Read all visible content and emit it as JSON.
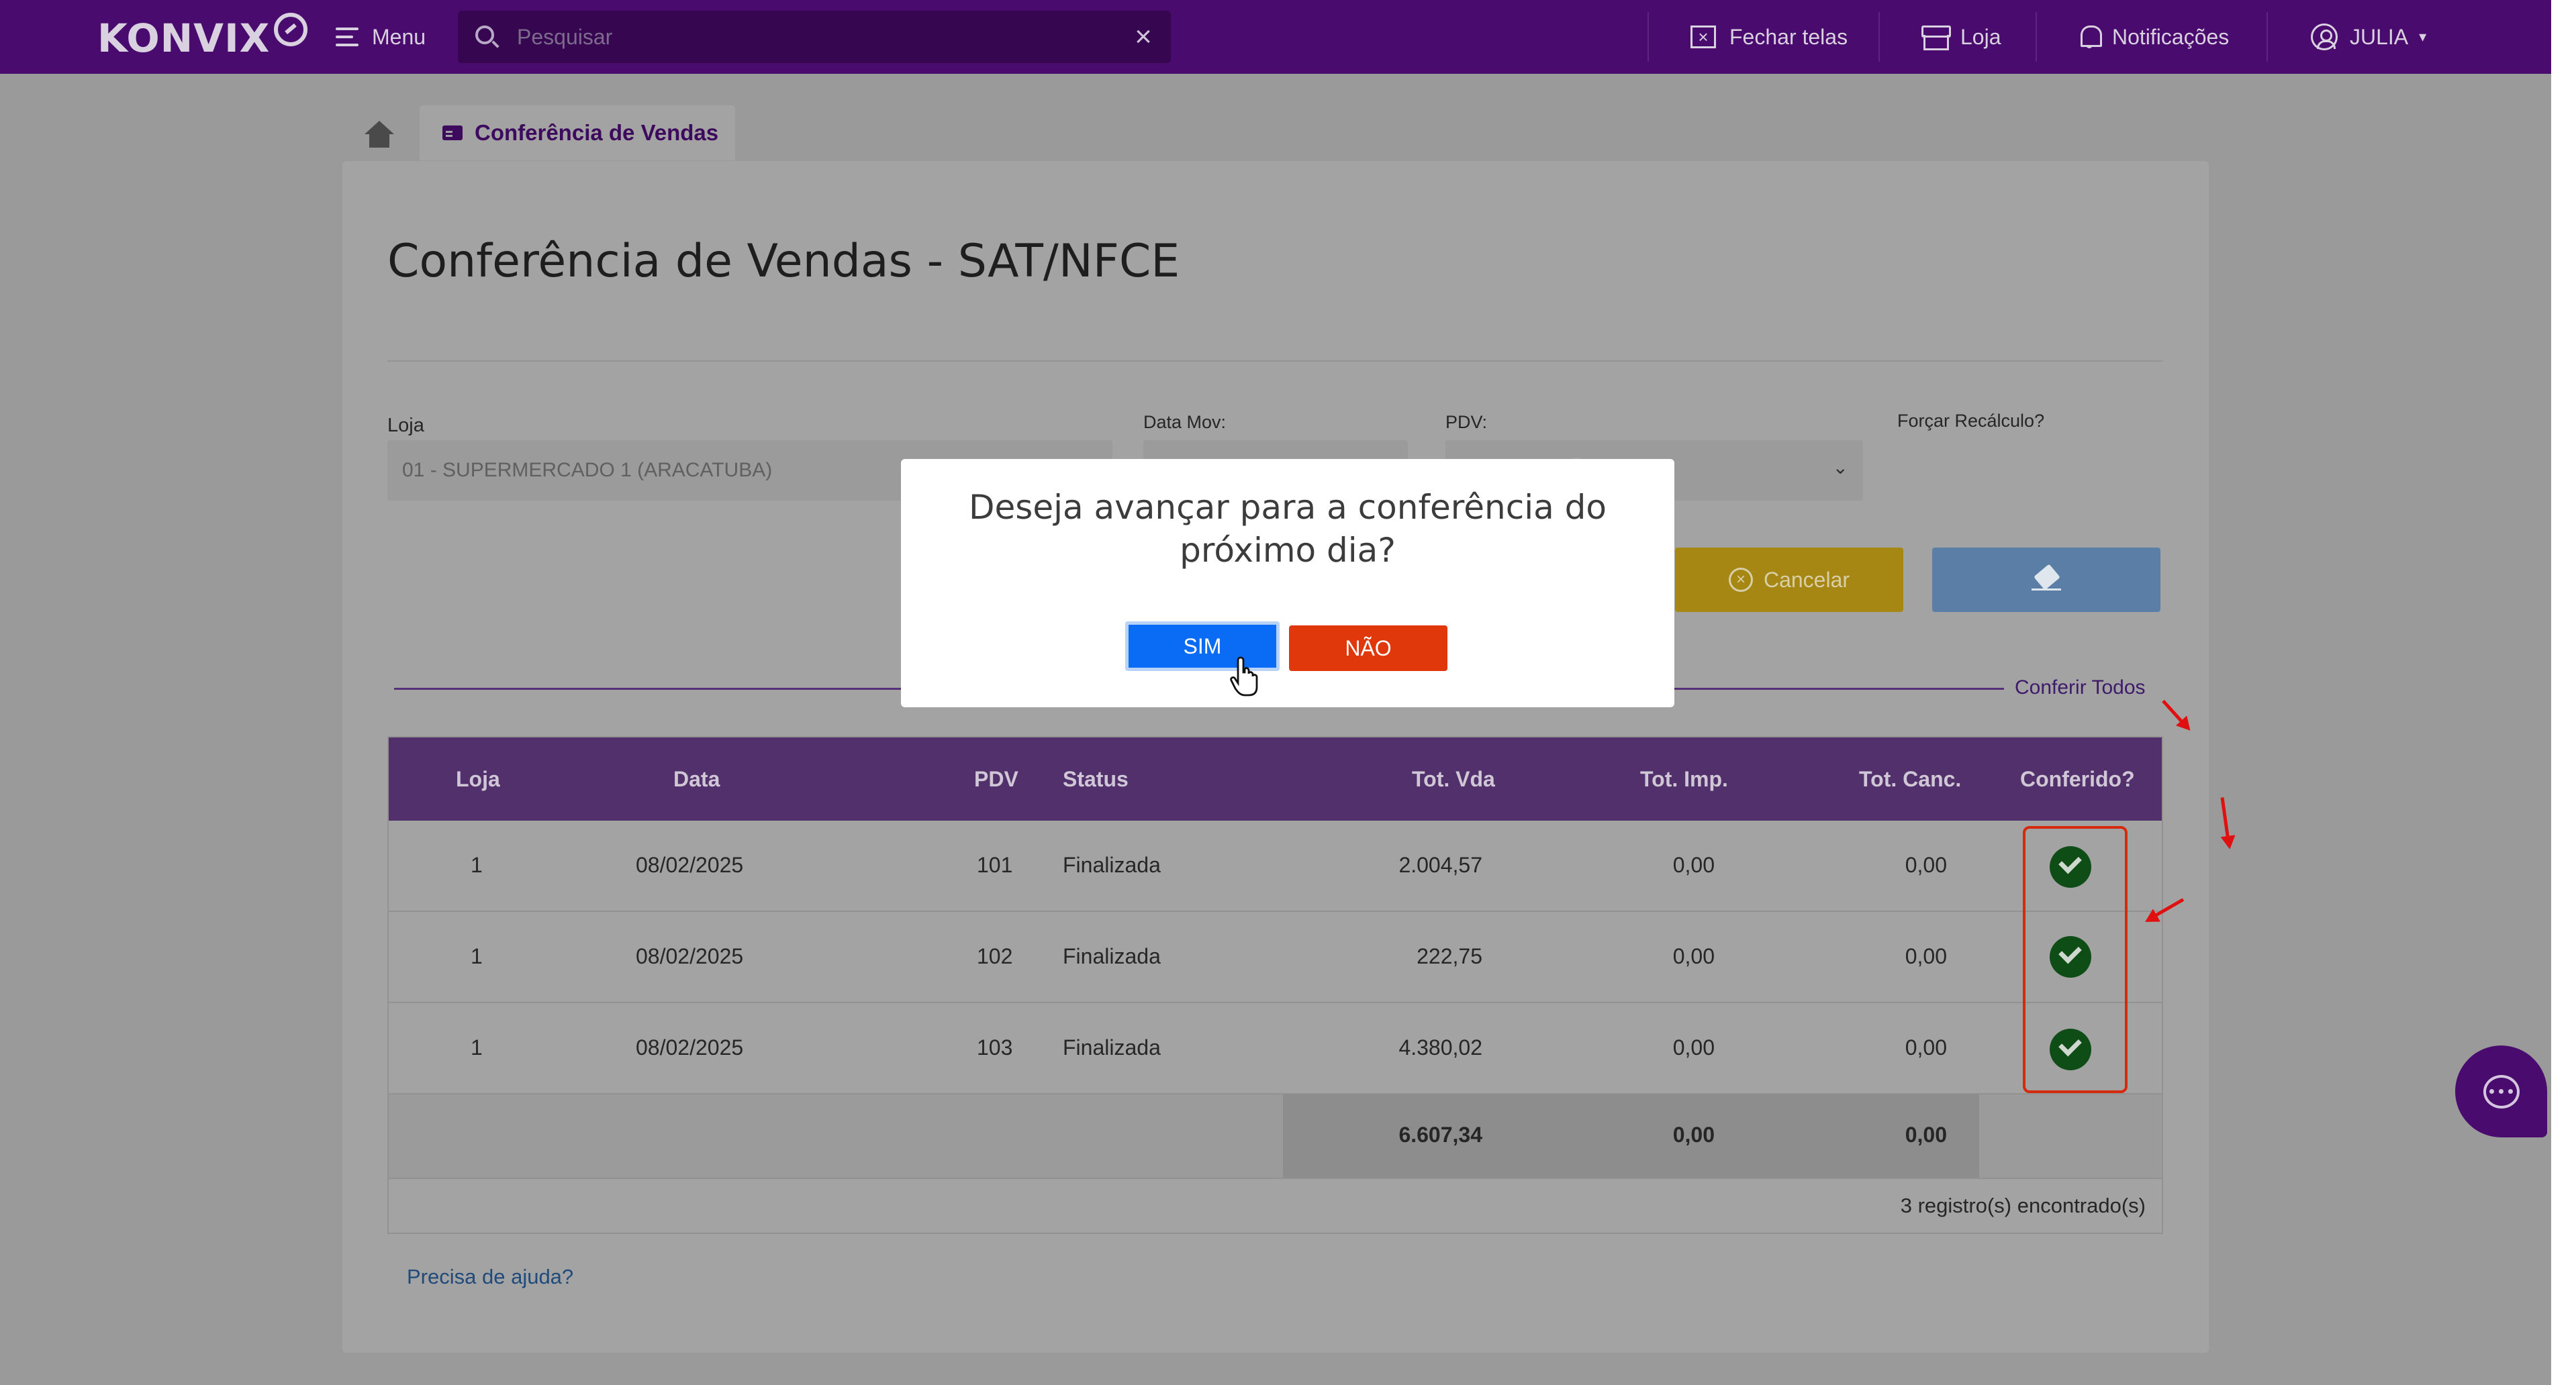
{
  "app": {
    "logo_text": "KONVIX"
  },
  "topbar": {
    "menu_label": "Menu",
    "search_placeholder": "Pesquisar",
    "close_screens": "Fechar telas",
    "store": "Loja",
    "notifications": "Notificações",
    "user": "JULIA"
  },
  "tabs": {
    "active": "Conferência de Vendas"
  },
  "page": {
    "title": "Conferência de Vendas - SAT/NFCE",
    "filters": {
      "loja_label": "Loja",
      "loja_value": "01 - SUPERMERCADO 1 (ARACATUBA)",
      "data_mov_label": "Data Mov:",
      "pdv_label": "PDV:",
      "forcar_label": "Forçar Recálculo?"
    },
    "cancel_label": "Cancelar",
    "conferir_todos": "Conferir Todos",
    "help_link": "Precisa de ajuda?"
  },
  "table": {
    "headers": [
      "Loja",
      "Data",
      "PDV",
      "Status",
      "Tot. Vda",
      "Tot. Imp.",
      "Tot. Canc.",
      "Conferido?"
    ],
    "rows": [
      {
        "loja": "1",
        "data": "08/02/2025",
        "pdv": "101",
        "status": "Finalizada",
        "tot_vda": "2.004,57",
        "tot_imp": "0,00",
        "tot_canc": "0,00",
        "conferido": true
      },
      {
        "loja": "1",
        "data": "08/02/2025",
        "pdv": "102",
        "status": "Finalizada",
        "tot_vda": "222,75",
        "tot_imp": "0,00",
        "tot_canc": "0,00",
        "conferido": true
      },
      {
        "loja": "1",
        "data": "08/02/2025",
        "pdv": "103",
        "status": "Finalizada",
        "tot_vda": "4.380,02",
        "tot_imp": "0,00",
        "tot_canc": "0,00",
        "conferido": true
      }
    ],
    "totals": {
      "tot_vda": "6.607,34",
      "tot_imp": "0,00",
      "tot_canc": "0,00"
    },
    "records": "3 registro(s) encontrado(s)"
  },
  "modal": {
    "question": "Deseja avançar para a conferência do próximo dia?",
    "yes": "SIM",
    "no": "NÃO"
  },
  "colors": {
    "brand": "#4a0b6e",
    "primary": "#0a6cf5",
    "danger": "#e0380b",
    "success": "#0f4d16",
    "annotation": "#e01010"
  }
}
